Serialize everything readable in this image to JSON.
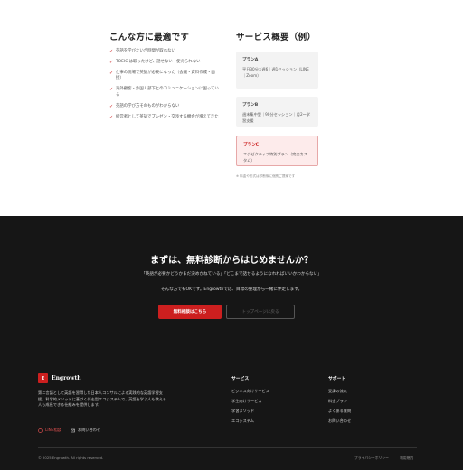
{
  "fit": {
    "title": "こんな方に最適です",
    "items": [
      "英語を学びたいが時間が取れない",
      "TOEIC は取ったけど、話せない・使えられない",
      "仕事の現場で英語が必要になった（会議・資料作成・面接）",
      "海外顧客・外国人部下とのコミュニケーションに困っている",
      "英語の学び方そのものがわからない",
      "経営者として英語でプレゼン・交渉する機会が増えてきた"
    ]
  },
  "service": {
    "title": "サービス概要（例）",
    "plans": [
      {
        "name": "プランA",
        "desc": "平日30分×週6｜週1セッション（LINE｜Zoom）"
      },
      {
        "name": "プランB",
        "desc": "週末集中型｜90分セッション｜月2〜学習支援"
      },
      {
        "name": "プランC",
        "desc": "エグゼクティブ特別プラン（完全カスタム）"
      }
    ],
    "note": "※ 料金や形式は診断後に個別ご提案です"
  },
  "cta": {
    "title": "まずは、無料診断からはじめませんか？",
    "text1": "「英語が必要かどうかまだ決めかねている」「どこまで話せるようになれればいいかわからない」",
    "text2": "そんな方でもOKです。Engrowthでは、目標の整理から一緒に伴走します。",
    "primary_btn": "無料相談はこちら",
    "secondary_btn": "トップページに戻る"
  },
  "footer": {
    "logo_mark": "E",
    "logo_text": "Engrowth",
    "about": "第二言語として英語を習得した日本人コンサルによる実践的な英語学習支援。科学的メソッドに基づく伴走型エコシステムで、英語を学ぶ人も教える人も成長できる仕組みを提供します。",
    "line_label": "LINE相談",
    "contact_label": "お問い合わせ",
    "services_title": "サービス",
    "services": [
      "ビジネス向けサービス",
      "学生向けサービス",
      "学習メソッド",
      "エコシステム"
    ],
    "support_title": "サポート",
    "support": [
      "受講の流れ",
      "料金プラン",
      "よくある質問",
      "お問い合わせ"
    ],
    "copyright": "© 2025 Engrowth. All rights reserved.",
    "privacy": "プライバシーポリシー",
    "terms": "利用規約"
  },
  "colors": {
    "accent": "#cc1f1f",
    "dark_bg": "#161616"
  }
}
